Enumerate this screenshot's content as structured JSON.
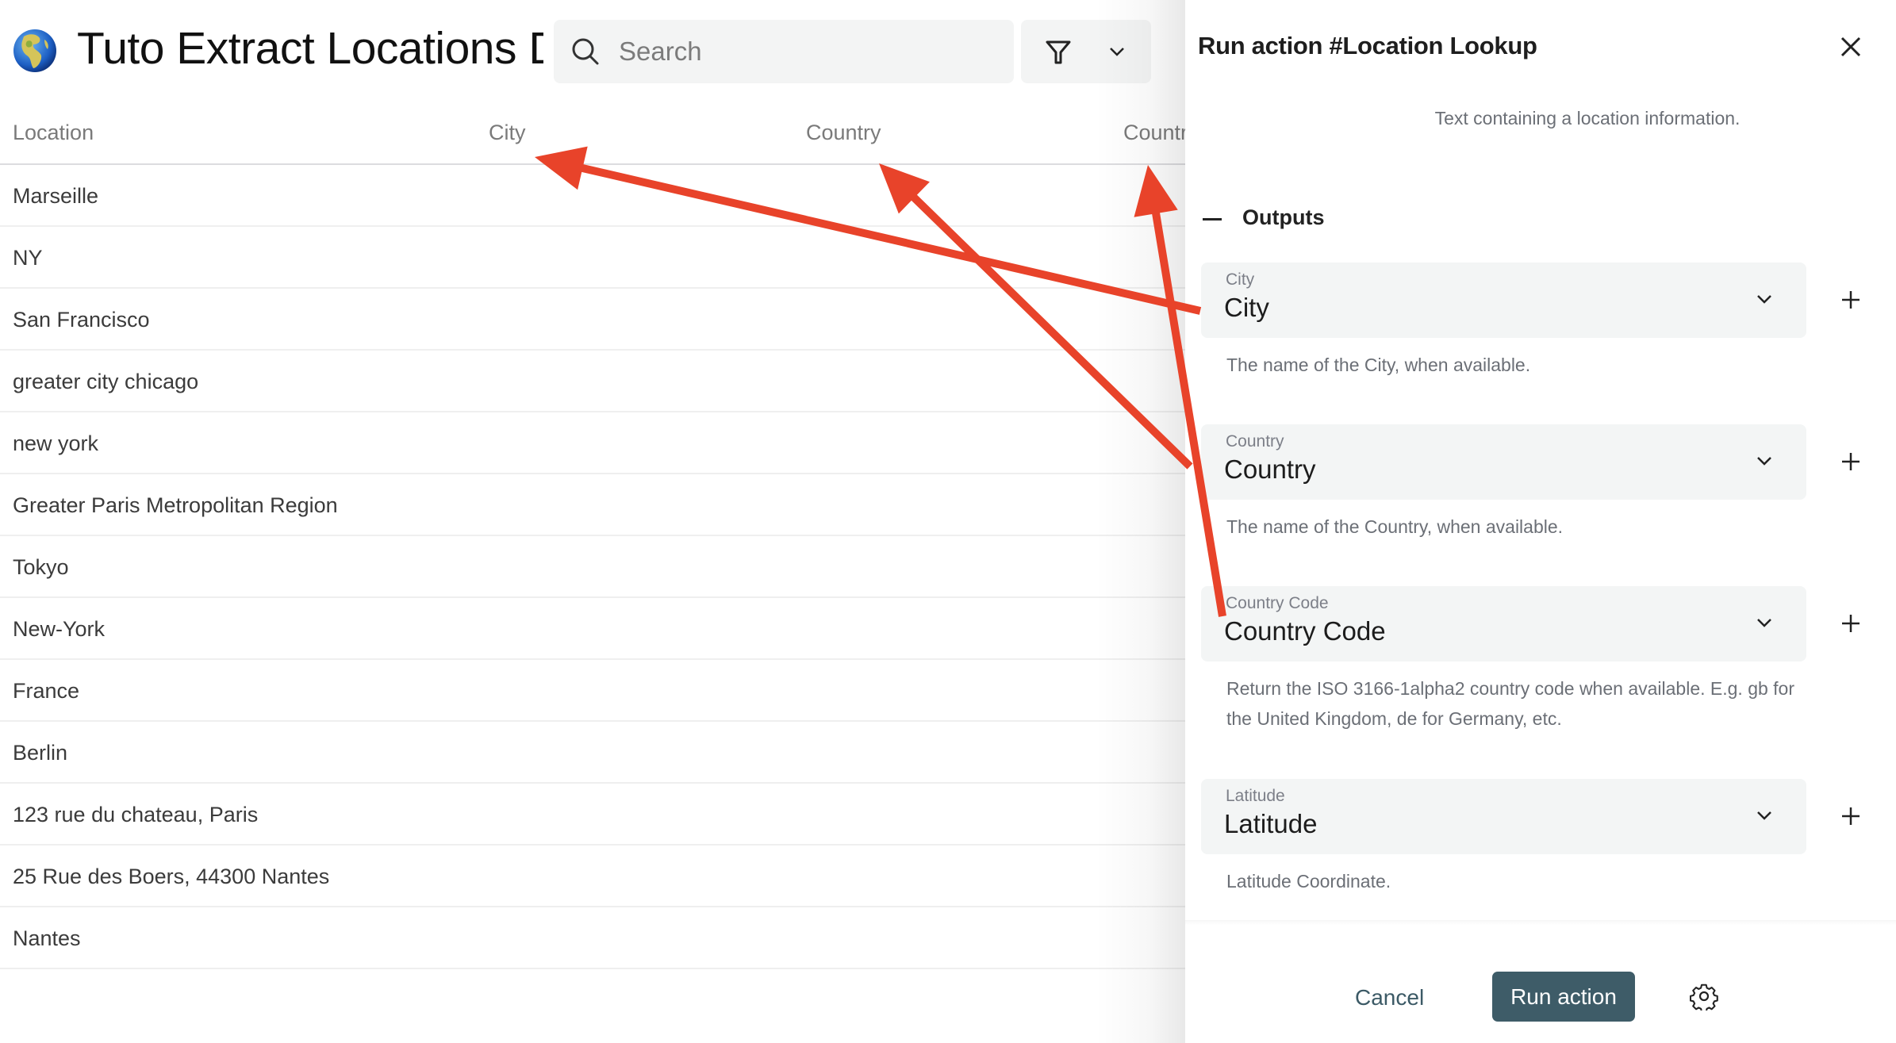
{
  "header": {
    "title": "Tuto Extract Locations D",
    "globe_icon": "globe-europe-africa-icon",
    "search": {
      "placeholder": "Search",
      "value": ""
    },
    "filter_icon": "funnel-icon",
    "filter_dropdown_icon": "chevron-down-icon"
  },
  "table": {
    "columns": [
      "Location",
      "City",
      "Country",
      "Countr"
    ],
    "rows": [
      {
        "location": "Marseille"
      },
      {
        "location": "NY"
      },
      {
        "location": "San Francisco"
      },
      {
        "location": "greater city chicago"
      },
      {
        "location": "new york"
      },
      {
        "location": "Greater Paris Metropolitan Region"
      },
      {
        "location": "Tokyo"
      },
      {
        "location": "New-York"
      },
      {
        "location": "France"
      },
      {
        "location": "Berlin"
      },
      {
        "location": "123 rue du chateau, Paris"
      },
      {
        "location": "25 Rue des Boers, 44300 Nantes"
      },
      {
        "location": "Nantes"
      }
    ]
  },
  "panel": {
    "title": "Run action #Location Lookup",
    "close_icon": "close-icon",
    "input_description": "Text containing a location information.",
    "outputs_label": "Outputs",
    "outputs": [
      {
        "label": "City",
        "value": "City",
        "help": "The name of the City, when available."
      },
      {
        "label": "Country",
        "value": "Country",
        "help": "The name of the Country, when available."
      },
      {
        "label": "Country Code",
        "value": "Country Code",
        "help": "Return the ISO 3166-1alpha2 country code when available. E.g. gb for the United Kingdom, de for Germany, etc."
      },
      {
        "label": "Latitude",
        "value": "Latitude",
        "help": "Latitude Coordinate."
      }
    ],
    "footer": {
      "cancel_label": "Cancel",
      "run_label": "Run action",
      "settings_icon": "gear-icon"
    }
  },
  "annotations": {
    "arrow_color": "#e8432a",
    "arrows": [
      {
        "from": "output-city",
        "to": "column-City"
      },
      {
        "from": "output-country",
        "to": "column-Country"
      },
      {
        "from": "output-country-code",
        "to": "column-Countr"
      }
    ]
  },
  "colors": {
    "primary_button": "#3e5c68",
    "field_background": "#f3f5f5",
    "search_background": "#f3f4f4",
    "muted_text": "#6b6f76"
  }
}
